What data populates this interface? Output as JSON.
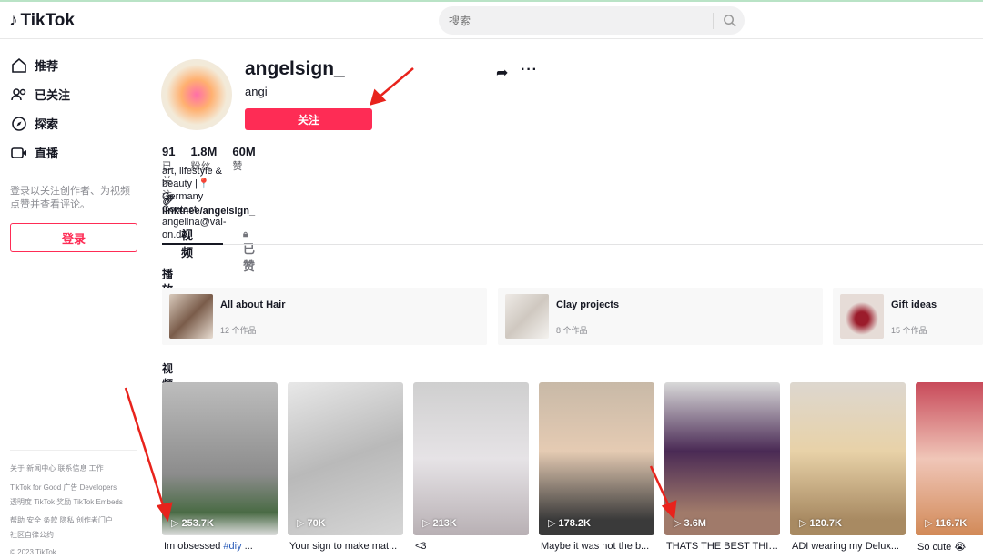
{
  "header": {
    "logo": "TikTok",
    "search_placeholder": "搜索"
  },
  "sidebar": {
    "nav": [
      {
        "label": "推荐",
        "icon": "home-icon"
      },
      {
        "label": "已关注",
        "icon": "users-icon"
      },
      {
        "label": "探索",
        "icon": "compass-icon"
      },
      {
        "label": "直播",
        "icon": "live-icon"
      }
    ],
    "login_hint": "登录以关注创作者、为视频点赞并查看评论。",
    "login_label": "登录",
    "footer": [
      "关于  新闻中心  联系信息  工作",
      "TikTok for Good  广告  Developers",
      "透明度  TikTok 奖励  TikTok Embeds",
      "帮助  安全  条款  隐私  创作者门户",
      "社区自律公约",
      "© 2023 TikTok"
    ]
  },
  "profile": {
    "username": "angelsign_",
    "nickname": "angi",
    "follow_label": "关注",
    "stats": [
      {
        "value": "91",
        "label": "已关注"
      },
      {
        "value": "1.8M",
        "label": "粉丝"
      },
      {
        "value": "60M",
        "label": "赞"
      }
    ],
    "bio_line1": "art, lifestyle & beauty |📍Germany",
    "bio_line2": "Contact: angelina@val-on.de",
    "link": "linktr.ee/angelsign_"
  },
  "tabs": [
    {
      "label": "视频",
      "active": true
    },
    {
      "label": "已赞",
      "active": false
    }
  ],
  "playlists_title": "播放列表",
  "playlists": [
    {
      "title": "All about Hair",
      "count": "12 个作品"
    },
    {
      "title": "Clay projects",
      "count": "8 个作品"
    },
    {
      "title": "Gift ideas",
      "count": "15 个作品"
    }
  ],
  "videos_title": "视频",
  "videos": [
    {
      "views": "253.7K",
      "caption": "Im obsessed ",
      "tag": "#diy",
      "suffix": " ..."
    },
    {
      "views": "70K",
      "caption": "Your sign to make mat..."
    },
    {
      "views": "213K",
      "caption": "<3"
    },
    {
      "views": "178.2K",
      "caption": "Maybe it was not the b..."
    },
    {
      "views": "3.6M",
      "caption": "THATS THE BEST THIN..."
    },
    {
      "views": "120.7K",
      "caption": "ADI wearing my Delux..."
    },
    {
      "views": "116.7K",
      "caption": "So cute 😭"
    }
  ],
  "colors": {
    "accent": "#fe2c55",
    "annotation": "#e8231c"
  }
}
